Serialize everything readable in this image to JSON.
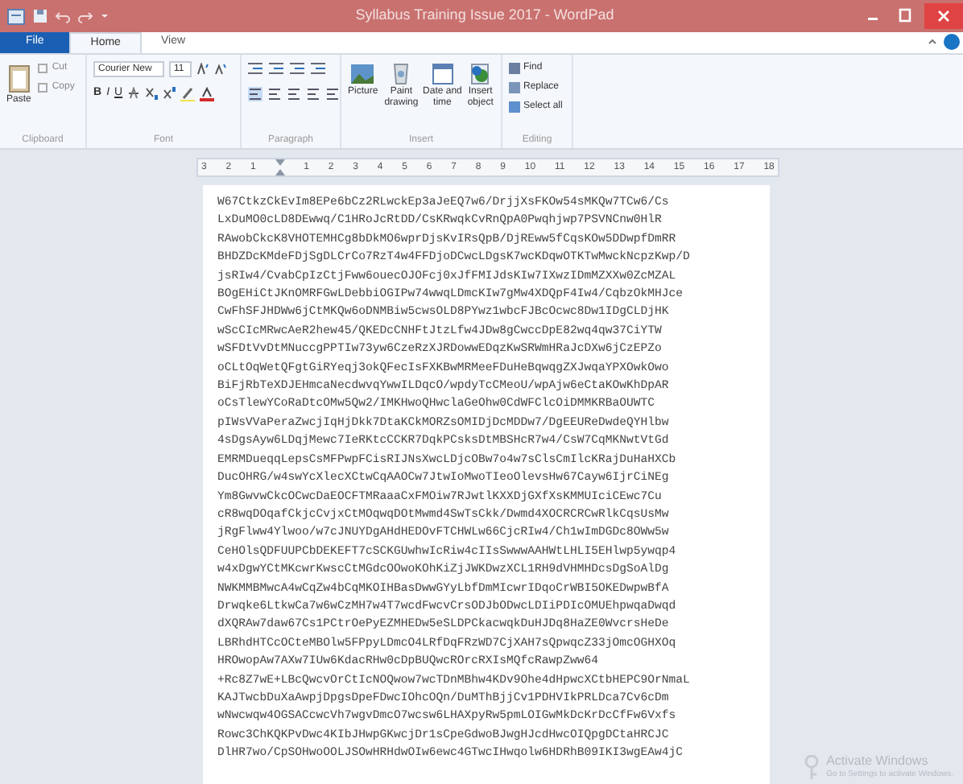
{
  "window": {
    "title": "Syllabus Training Issue 2017 - WordPad"
  },
  "tabs": [
    {
      "label": "File",
      "selected": false,
      "kind": "file"
    },
    {
      "label": "Home",
      "selected": true,
      "kind": "tab"
    },
    {
      "label": "View",
      "selected": false,
      "kind": "tab"
    }
  ],
  "ribbon": {
    "clipboard": {
      "label": "Clipboard",
      "paste": "Paste",
      "cut": "Cut",
      "copy": "Copy"
    },
    "font": {
      "label": "Font",
      "family": "Courier New",
      "size": "11",
      "bold": "B",
      "italic": "I",
      "underline": "U"
    },
    "paragraph": {
      "label": "Paragraph"
    },
    "insert": {
      "label": "Insert",
      "items": [
        {
          "line1": "Picture",
          "kind": "picture"
        },
        {
          "line1": "Paint",
          "line2": "drawing",
          "kind": "paint"
        },
        {
          "line1": "Date and",
          "line2": "time",
          "kind": "date"
        },
        {
          "line1": "Insert",
          "line2": "object",
          "kind": "object"
        }
      ]
    },
    "editing": {
      "label": "Editing",
      "items": [
        "Find",
        "Replace",
        "Select all"
      ]
    }
  },
  "ruler": [
    "3",
    "2",
    "1",
    "1",
    "2",
    "3",
    "4",
    "5",
    "6",
    "7",
    "8",
    "9",
    "10",
    "11",
    "12",
    "13",
    "14",
    "15",
    "16",
    "17",
    "18"
  ],
  "document": {
    "lines": [
      "W67CtkzCkEvIm8EPe6bCz2RLwckEp3aJeEQ7w6/DrjjXsFKOw54sMKQw7TCw6/Cs",
      "LxDuMO0cLD8DEwwq/C1HRoJcRtDD/CsKRwqkCvRnQpA0Pwqhjwp7PSVNCnw0HlR",
      "RAwobCkcK8VHOTEMHCg8bDkMO6wprDjsKvIRsQpB/DjREww5fCqsKOw5DDwpfDmRR",
      "BHDZDcKMdeFDjSgDLCrCo7RzT4w4FFDjoDCwcLDgsK7wcKDqwOTKTwMwckNcpzKwp/D",
      "jsRIw4/CvabCpIzCtjFww6ouecOJOFcj0xJfFMIJdsKIw7IXwzIDmMZXXw0ZcMZAL",
      "BOgEHiCtJKnOMRFGwLDebbiOGIPw74wwqLDmcKIw7gMw4XDQpF4Iw4/CqbzOkMHJce",
      "CwFhSFJHDWw6jCtMKQw6oDNMBiw5cwsOLD8PYwz1wbcFJBcOcwc8Dw1IDgCLDjHK",
      "wScCIcMRwcAeR2hew45/QKEDcCNHFtJtzLfw4JDw8gCwccDpE82wq4qw37CiYTW",
      "wSFDtVvDtMNuccgPPTIw73yw6CzeRzXJRDowwEDqzKwSRWmHRaJcDXw6jCzEPZo",
      "oCLtOqWetQFgtGiRYeqj3okQFecIsFXKBwMRMeeFDuHeBqwqgZXJwqaYPXOwkOwo",
      "BiFjRbTeXDJEHmcaNecdwvqYwwILDqcO/wpdyTcCMeoU/wpAjw6eCtaKOwKhDpAR",
      "oCsTlewYCoRaDtcOMw5Qw2/IMKHwoQHwclaGeOhw0CdWFClcOiDMMKRBaOUWTC",
      "pIWsVVaPeraZwcjIqHjDkk7DtaKCkMORZsOMIDjDcMDDw7/DgEEUReDwdeQYHlbw",
      "4sDgsAyw6LDqjMewc7IeRKtcCCKR7DqkPCsksDtMBSHcR7w4/CsW7CqMKNwtVtGd",
      "EMRMDueqqLepsCsMFPwpFCisRIJNsXwcLDjcOBw7o4w7sClsCmIlcKRajDuHaHXCb",
      "DucOHRG/w4swYcXlecXCtwCqAAOCw7JtwIoMwoTIeoOlevsHw67Cayw6IjrCiNEg",
      "Ym8GwvwCkcOCwcDaEOCFTMRaaaCxFMOiw7RJwtlKXXDjGXfXsKMMUIciCEwc7Cu",
      "cR8wqDOqafCkjcCvjxCtMOqwqDOtMwmd4SwTsCkk/Dwmd4XOCRCRCwRlkCqsUsMw",
      "jRgFlww4Ylwoo/w7cJNUYDgAHdHEDOvFTCHWLw66CjcRIw4/Ch1wImDGDc8OWw5w",
      "CeHOlsQDFUUPCbDEKEFT7cSCKGUwhwIcRiw4cIIsSwwwAAHWtLHLI5EHlwp5ywqp4",
      "w4xDgwYCtMKcwrKwscCtMGdcOOwoKOhKiZjJWKDwzXCL1RH9dVHMHDcsDgSoAlDg",
      "NWKMMBMwcA4wCqZw4bCqMKOIHBasDwwGYyLbfDmMIcwrIDqoCrWBI5OKEDwpwBfA",
      "Drwqke6LtkwCa7w6wCzMH7w4T7wcdFwcvCrsODJbODwcLDIiPDIcOMUEhpwqaDwqd",
      "dXQRAw7daw67Cs1PCtrOePyEZMHEDw5eSLDPCkacwqkDuHJDq8HaZE0WvcrsHeDe",
      "LBRhdHTCcOCteMBOlw5FPpyLDmcO4LRfDqFRzWD7CjXAH7sQpwqcZ33jOmcOGHXOq",
      "HROwopAw7AXw7IUw6KdacRHw0cDpBUQwcROrcRXIsMQfcRawpZww64",
      "+Rc8Z7wE+LBcQwcvOrCtIcNOQwow7wcTDnMBhw4KDv9Ohe4dHpwcXCtbHEPC9OrNmaL",
      "KAJTwcbDuXaAwpjDpgsDpeFDwcIOhcOQn/DuMThBjjCv1PDHVIkPRLDca7Cv6cDm",
      "wNwcwqw4OGSACcwcVh7wgvDmcO7wcsw6LHAXpyRw5pmLOIGwMkDcKrDcCfFw6Vxfs",
      "Rowc3ChKQKPvDwc4KIbJHwpGKwcjDr1sCpeGdwoBJwgHJcdHwcOIQpgDCtaHRCJC",
      "DlHR7wo/CpSOHwoOOLJSOwHRHdwOIw6ewc4GTwcIHwqolw6HDRhB09IKI3wgEAw4jC"
    ]
  },
  "activation": {
    "title": "Activate Windows",
    "hint": "Go to Settings to activate Windows."
  }
}
